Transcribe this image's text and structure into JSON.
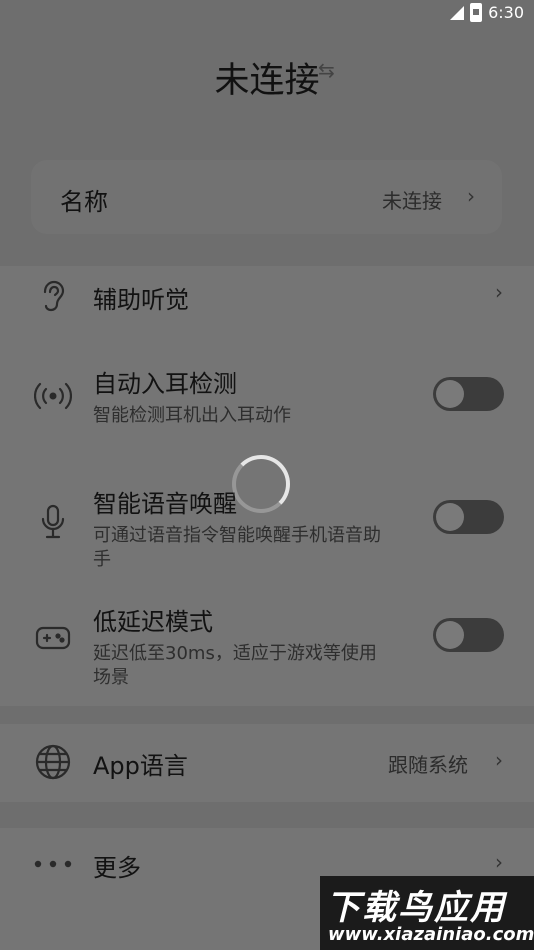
{
  "status_bar": {
    "time": "6:30"
  },
  "header": {
    "title": "未连接"
  },
  "device_card": {
    "label": "名称",
    "value": "未连接"
  },
  "settings": {
    "hearing_aid": {
      "label": "辅助听觉"
    },
    "ear_detection": {
      "label": "自动入耳检测",
      "subtitle": "智能检测耳机出入耳动作",
      "enabled": false
    },
    "voice_wake": {
      "label": "智能语音唤醒",
      "subtitle_line1": "可通过语音指令智能唤醒手机语音助",
      "subtitle_line2": "手",
      "enabled": false
    },
    "low_latency": {
      "label": "低延迟模式",
      "subtitle_line1": "延迟低至30ms，适应于游戏等使用",
      "subtitle_line2": "场景",
      "enabled": false
    }
  },
  "language": {
    "label": "App语言",
    "value": "跟随系统"
  },
  "more": {
    "label": "更多"
  },
  "watermark": {
    "text": "下载鸟应用",
    "url": "www.xiazainiao.com"
  },
  "icons": [
    "ear-icon",
    "wireless-signal-icon",
    "microphone-icon",
    "gamepad-icon",
    "globe-icon",
    "more-dots-icon",
    "swap-arrows-icon",
    "chevron-right-icon"
  ]
}
